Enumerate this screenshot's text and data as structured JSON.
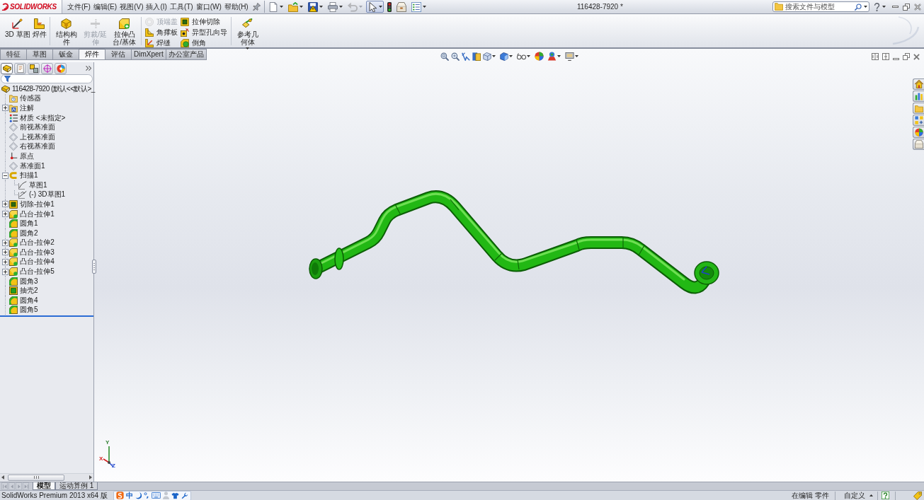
{
  "app": {
    "logo": "SOLIDWORKS",
    "menu": [
      "文件(F)",
      "编辑(E)",
      "视图(V)",
      "插入(I)",
      "工具(T)",
      "窗口(W)",
      "帮助(H)"
    ],
    "title": "116428-7920 *",
    "search": {
      "placeholder": "搜索文件与模型"
    }
  },
  "quick_toolbar": [
    {
      "kind": "new",
      "dropdown": true,
      "disabled": false,
      "pressed": false
    },
    {
      "kind": "open",
      "dropdown": true,
      "disabled": false,
      "pressed": false
    },
    {
      "kind": "save",
      "dropdown": true,
      "disabled": false,
      "pressed": false
    },
    {
      "kind": "print",
      "dropdown": true,
      "disabled": false,
      "pressed": false
    },
    {
      "kind": "undo",
      "dropdown": true,
      "disabled": true,
      "pressed": false
    },
    {
      "kind": "select",
      "dropdown": true,
      "disabled": false,
      "pressed": true
    },
    {
      "kind": "rebuild",
      "dropdown": false,
      "disabled": false,
      "pressed": false
    },
    {
      "kind": "file_properties",
      "dropdown": false,
      "disabled": false,
      "pressed": false
    },
    {
      "kind": "options",
      "dropdown": true,
      "disabled": false,
      "pressed": false
    }
  ],
  "command_manager": {
    "groups": [
      {
        "kind": "large",
        "items": [
          {
            "kind": "sketch3d",
            "label": "3D 草图",
            "disabled": false,
            "dropdown": false
          },
          {
            "kind": "weldment",
            "label": "焊件",
            "disabled": false,
            "dropdown": false
          }
        ]
      },
      {
        "kind": "large",
        "items": [
          {
            "kind": "structural_member",
            "label": "结构构件",
            "disabled": false,
            "dropdown": false
          },
          {
            "kind": "trim",
            "label": "剪裁/延伸",
            "disabled": true,
            "dropdown": false
          },
          {
            "kind": "boss",
            "label": "拉伸凸台/基体",
            "disabled": false,
            "dropdown": false
          }
        ]
      },
      {
        "kind": "stack",
        "items": [
          {
            "kind": "end_cap",
            "label": "顶端盖",
            "disabled": true
          },
          {
            "kind": "gusset",
            "label": "角撑板",
            "disabled": false
          },
          {
            "kind": "weld_bead",
            "label": "焊缝",
            "disabled": false
          }
        ]
      },
      {
        "kind": "stack",
        "items": [
          {
            "kind": "cut",
            "label": "拉伸切除",
            "disabled": false
          },
          {
            "kind": "hole",
            "label": "异型孔向导",
            "disabled": false
          },
          {
            "kind": "chamfer",
            "label": "倒角",
            "disabled": false
          }
        ]
      },
      {
        "kind": "large",
        "items": [
          {
            "kind": "reference_geometry",
            "label": "参考几何体",
            "disabled": false,
            "dropdown": true
          }
        ]
      }
    ]
  },
  "tabs": [
    {
      "label": "特征",
      "selected": false
    },
    {
      "label": "草图",
      "selected": false
    },
    {
      "label": "钣金",
      "selected": false
    },
    {
      "label": "焊件",
      "selected": true
    },
    {
      "label": "评估",
      "selected": false
    },
    {
      "label": "DimXpert",
      "selected": false
    },
    {
      "label": "办公室产品",
      "selected": false
    }
  ],
  "feature_manager": {
    "panel_tabs": [
      {
        "kind": "feature_tree",
        "selected": true
      },
      {
        "kind": "property_manager",
        "selected": false
      },
      {
        "kind": "configuration_manager",
        "selected": false
      },
      {
        "kind": "dimxpert",
        "selected": false
      },
      {
        "kind": "display_manager",
        "selected": false
      }
    ],
    "tree": [
      {
        "kind": "part",
        "label": "116428-7920 (默认<<默认>_",
        "children": [
          {
            "kind": "sensors",
            "label": "传感器"
          },
          {
            "kind": "annotations",
            "label": "注解",
            "expanded": false
          },
          {
            "kind": "material",
            "label": "材质 <未指定>"
          },
          {
            "kind": "plane",
            "label": "前视基准面"
          },
          {
            "kind": "plane",
            "label": "上视基准面"
          },
          {
            "kind": "plane",
            "label": "右视基准面"
          },
          {
            "kind": "origin",
            "label": "原点"
          },
          {
            "kind": "plane",
            "label": "基准面1"
          },
          {
            "kind": "sweep",
            "label": "扫描1",
            "expanded": true,
            "children": [
              {
                "kind": "sketch",
                "label": "草图1"
              },
              {
                "kind": "sketch3d",
                "label": "(-) 3D草图1"
              }
            ]
          },
          {
            "kind": "cut",
            "label": "切除-拉伸1",
            "expanded": false
          },
          {
            "kind": "boss",
            "label": "凸台-拉伸1",
            "expanded": false
          },
          {
            "kind": "fillet",
            "label": "圆角1"
          },
          {
            "kind": "fillet",
            "label": "圆角2"
          },
          {
            "kind": "boss",
            "label": "凸台-拉伸2",
            "expanded": false
          },
          {
            "kind": "boss",
            "label": "凸台-拉伸3",
            "expanded": false
          },
          {
            "kind": "boss",
            "label": "凸台-拉伸4",
            "expanded": false
          },
          {
            "kind": "boss",
            "label": "凸台-拉伸5",
            "expanded": false
          },
          {
            "kind": "fillet",
            "label": "圆角3"
          },
          {
            "kind": "shell",
            "label": "抽壳2"
          },
          {
            "kind": "fillet",
            "label": "圆角4"
          },
          {
            "kind": "fillet",
            "label": "圆角5"
          }
        ]
      }
    ]
  },
  "bottom_tabs": {
    "nav_buttons": [
      {
        "kind": "first",
        "disabled": true
      },
      {
        "kind": "prev",
        "disabled": true
      },
      {
        "kind": "next",
        "disabled": true
      },
      {
        "kind": "last",
        "disabled": true
      }
    ],
    "tabs": [
      {
        "label": "模型",
        "selected": true
      },
      {
        "label": "运动算例 1",
        "selected": false
      }
    ]
  },
  "triad": {
    "y": "Y",
    "x": "X",
    "z": "Z"
  },
  "status_bar": {
    "product": "SolidWorks Premium 2013 x64 版",
    "ime": "中",
    "mode": "在编辑 零件",
    "units": "自定义"
  }
}
